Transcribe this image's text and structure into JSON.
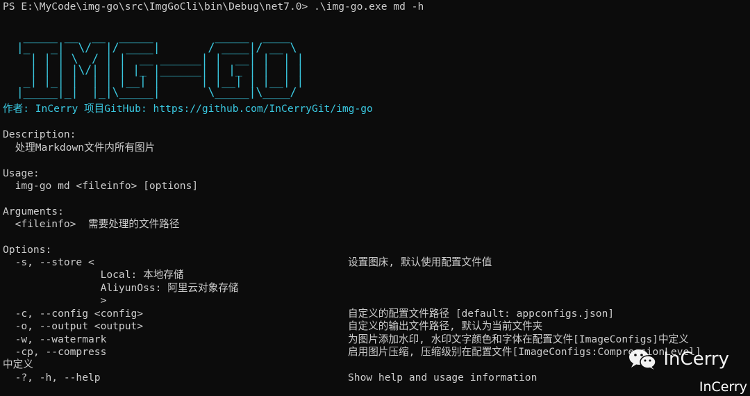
{
  "terminal": {
    "prompt": "PS E:\\MyCode\\img-go\\src\\ImgGoCli\\bin\\Debug\\net7.0> .\\img-go.exe md -h",
    "ascii_art": "   _____ __  __  _____         _____  ____  \n  |_   _|  \\/  |/ ____|       / ____|/ __ \\ \n    | | | \\  / | |  __ ______| |  __| |  | |\n    | | | |\\/| | | |_ |______| | |_ | |  | |\n   _| |_| |  | | |__| |      | |__| | |__| |\n  |_____|_|  |_|\\_____|       \\_____|\\____/ ",
    "author_line": "作者: InCerry 项目GitHub: https://github.com/InCerryGit/img-go",
    "description_heading": "Description:",
    "description_text": "  处理Markdown文件内所有图片",
    "usage_heading": "Usage:",
    "usage_text": "  img-go md <fileinfo> [options]",
    "arguments_heading": "Arguments:",
    "argument_text": "  <fileinfo>  需要处理的文件路径",
    "options_heading": "Options:",
    "options": {
      "store": "  -s, --store <",
      "store_local": "                Local: 本地存储",
      "store_aliyun": "                AliyunOss: 阿里云对象存储",
      "store_close": "                >",
      "store_desc": "设置图床, 默认使用配置文件值",
      "config": "  -c, --config <config>",
      "config_desc": "自定义的配置文件路径 [default: appconfigs.json]",
      "output": "  -o, --output <output>",
      "output_desc": "自定义的输出文件路径, 默认为当前文件夹",
      "watermark": "  -w, --watermark",
      "watermark_desc": "为图片添加水印, 水印文字颜色和字体在配置文件[ImageConfigs]中定义",
      "compress": "  -cp, --compress",
      "compress_desc": "启用图片压缩, 压缩级别在配置文件[ImageConfigs:CompressionLevel]",
      "compress_wrap": "中定义",
      "help": "  -?, -h, --help",
      "help_desc": "Show help and usage information"
    }
  },
  "watermark": {
    "brand": "InCerry",
    "corner": "InCerry",
    "icon": "wechat-icon"
  },
  "colors": {
    "background": "#0c0c0c",
    "text": "#cccccc",
    "accent": "#3ac8e0"
  }
}
